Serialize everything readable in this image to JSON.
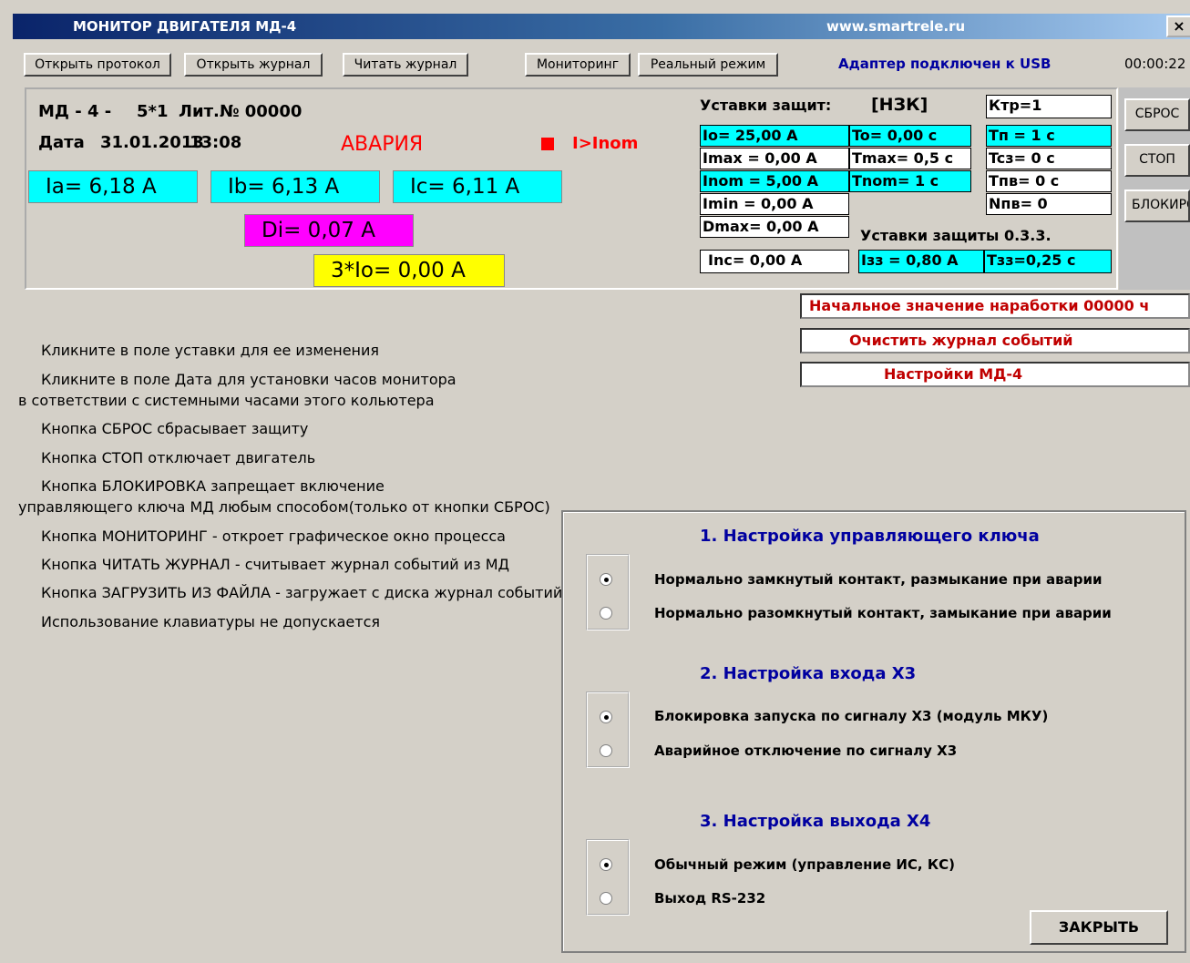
{
  "window": {
    "title": "МОНИТОР ДВИГАТЕЛЯ МД-4",
    "url": "www.smartrele.ru",
    "close": "×"
  },
  "toolbar": {
    "open_protocol": "Открыть протокол",
    "open_journal": "Открыть журнал",
    "read_journal": "Читать журнал",
    "monitoring": "Мониторинг",
    "realtime": "Реальный режим",
    "usb_status": "Адаптер подключен к USB",
    "clock": "00:00:22"
  },
  "device": {
    "model": "МД - 4 -",
    "variant": "5*1",
    "lit": "Лит.№ 00000",
    "date_label": "Дата",
    "date": "31.01.2013",
    "time": "13:08",
    "alarm": "АВАРИЯ",
    "trip_reason": "I>Inom",
    "ia": "Ia= 6,18  A",
    "ib": "Ib= 6,13  A",
    "ic": "Ic= 6,11  A",
    "di": "Di= 0,07  A",
    "i0x3": "3*Io= 0,00  A"
  },
  "settings": {
    "title": "Уставки защит:",
    "type": "[НЗК]",
    "ktr": "Ктр=1",
    "io": "Io=   25,00  A",
    "imax": "Imax   = 0,00  A",
    "inom": "Inom  = 5,00  A",
    "imin": "Imin   = 0,00  A",
    "dmax": "Dmax= 0,00  A",
    "to": "To=     0,00 c",
    "tmax": "Tmax= 0,5 c",
    "tnom": "Tnom= 1 c",
    "tp": "Tп   = 1 c",
    "tcz": "Tcз= 0 c",
    "tpv": "Tпв= 0 c",
    "npv": "Nпв= 0",
    "zz_title": "Уставки защиты 0.3.3.",
    "inc": "Inc= 0,00  A",
    "izz": "Iзз = 0,80  A",
    "tzz": "Tзз=0,25 c"
  },
  "side_buttons": {
    "reset": "СБРОС",
    "stop": "СТОП",
    "block": "БЛОКИРОВКА"
  },
  "actions": {
    "runtime": "Начальное значение наработки  00000 ч",
    "clear_journal": "Очистить журнал событий",
    "md4_settings": "Настройки МД-4"
  },
  "help": [
    "Кликните в  поле  уставки  для ее изменения",
    "Кликните в поле Дата для установки часов монитора",
    "в сответствии с системными часами этого кольютера",
    "Кнопка  СБРОС  сбрасывает   защиту",
    "Кнопка   СТОП   отключает   двигатель",
    "Кнопка БЛОКИРОВКА запрещает включение",
    "управляющего ключа МД любым способом(только от кнопки СБРОС)",
    "Кнопка МОНИТОРИНГ - откроет графическое окно процесса",
    "Кнопка ЧИТАТЬ ЖУРНАЛ - считывает журнал событий из МД",
    "Кнопка ЗАГРУЗИТЬ ИЗ ФАЙЛА - загружает с диска журнал событий",
    "Использование клавиатуры не допускается"
  ],
  "dialog": {
    "s1": "1.  Настройка управляющего ключа",
    "s1o1": "Нормально замкнутый контакт,     размыкание при аварии",
    "s1o2": "Нормально разомкнутый контакт,  замыкание при аварии",
    "s2": "2.  Настройка входа  Х3",
    "s2o1": "Блокировка запуска по сигналу Х3  (модуль МКУ)",
    "s2o2": "Аварийное отключение по сигналу Х3",
    "s3": "3.  Настройка выхода   Х4",
    "s3o1": "Обычный режим  (управление ИС, КС)",
    "s3o2": "Выход RS-232",
    "close": "ЗАКРЫТЬ"
  },
  "colors": {
    "current_bg": "#00ffff",
    "di_bg": "#ff00ff",
    "i0_bg": "#ffff00",
    "alarm": "#ff0000",
    "title_bar": "#0a246a"
  }
}
